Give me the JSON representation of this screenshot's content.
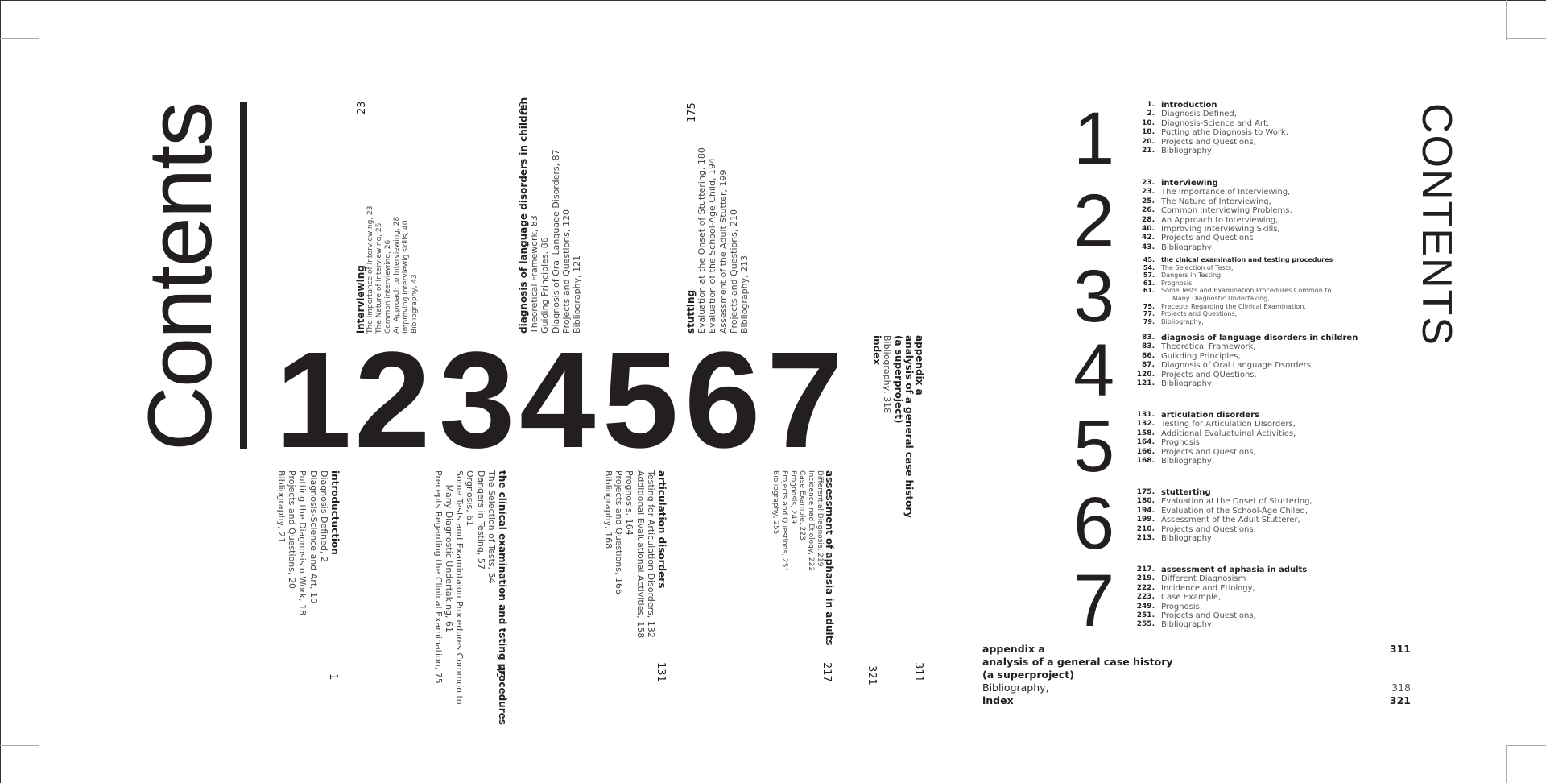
{
  "left": {
    "title": "Contents",
    "digits": [
      "1",
      "2",
      "3",
      "4",
      "5",
      "6",
      "7"
    ],
    "top_blocks": [
      {
        "num": "23",
        "heading": "interviewing",
        "items": [
          "The Importance of Interviewing, 23",
          "The Nature of Interviewing, 25",
          "Common interviewing, 26",
          "An Approach to Interviewing, 28",
          "Improving Interviewig skills, 40",
          "Bibliography, 43"
        ]
      },
      {
        "num": "83",
        "heading": "diagnosis of language disorders in children",
        "items": [
          "Theoretical Framework, 83",
          "Guiding Principles, 86",
          "Diagnosis of Oral Language Disorders, 87",
          "Projects and Questions, 120",
          "Bibliography, 121"
        ]
      },
      {
        "num": "175",
        "heading": "stutting",
        "items": [
          "Evaluation at the Onset of Stuttering, 180",
          "Evaluation  of the School-Age Child, 194",
          "Assessment of the Adult Stutter, 199",
          "Projects and Questions, 210",
          "Bibliography, 213"
        ]
      }
    ],
    "appendix_block": {
      "lines": [
        "appendix a",
        "analysis of a general case history",
        "(a superproject)",
        "Bibliography, 318",
        "index"
      ]
    },
    "bottom_blocks": [
      {
        "num": "1",
        "heading": "introductuction",
        "items": [
          "Diagnosis Defined, 2",
          "Diagnosis-Science and Art, 10",
          "Putting the Diagnosis o Work, 18",
          "Projects and Questions, 20",
          "Bibliography, 21"
        ]
      },
      {
        "num": "45",
        "heading": "the clinical examination and tsting procedures",
        "items": [
          "The Selection of Tests, 54",
          "Dangers in Testing, 57",
          "Orgnosis, 61",
          "Some Tests and Examintaion Procedures Common to",
          "     Many Diagnostic Undertaking, 61",
          "Precepts Regarding the Clinical Examination, 75"
        ]
      },
      {
        "num": "131",
        "heading": "articulation disorders",
        "items": [
          "Testing for Articulation Disorders, 132",
          "Additional Evaluational Activities, 158",
          "Prognosis, 164",
          "Projects and Questions, 166",
          "Bibliography, 168"
        ]
      },
      {
        "num": "217",
        "heading": "assessment of aphasia in adults",
        "items": [
          "Differential Diagnosis, 219",
          "Incidence nad Etiology, 222",
          "Case Example, 223",
          "Prognosis, 249",
          "Projects and Questions, 251",
          "Bibliography, 255"
        ]
      }
    ],
    "bottom_nums_extra": [
      "321",
      "311"
    ]
  },
  "right": {
    "title": "CONTENTS",
    "digits": [
      "1",
      "2",
      "3",
      "4",
      "5",
      "6",
      "7"
    ],
    "sections": [
      {
        "rows": [
          [
            "1.",
            "introduction"
          ],
          [
            "2.",
            "Diagnosis Defined,"
          ],
          [
            "10.",
            "Diagnosis-Science and Art,"
          ],
          [
            "18.",
            "Putting athe Diagnosis to Work,"
          ],
          [
            "20.",
            "Projects and Questions,"
          ],
          [
            "21.",
            "Bibliography,"
          ]
        ]
      },
      {
        "rows": [
          [
            "23.",
            "interviewing"
          ],
          [
            "23.",
            "The Importance of Interviewing,"
          ],
          [
            "25.",
            "The Nature of Interviewing,"
          ],
          [
            "26.",
            "Common Interviewing Problems,"
          ],
          [
            "28.",
            "An Approach to Interviewing,"
          ],
          [
            "40.",
            "Improving Interviewing Skills,"
          ],
          [
            "42.",
            "Projects and Questions"
          ],
          [
            "43.",
            "Bibliography"
          ]
        ]
      },
      {
        "rows": [
          [
            "45.",
            "the clnical examination and testing procedures"
          ],
          [
            "54.",
            "The Selection of Tests,"
          ],
          [
            "57.",
            "Dangers in Testing,"
          ],
          [
            "61.",
            "Prognosis,"
          ],
          [
            "61.",
            "Some Tests and Examination Procedures Common to"
          ],
          [
            "",
            "Many Diagnostic Undertaking,"
          ],
          [
            "75.",
            "Precepts Regarding the Clinical Examination,"
          ],
          [
            "77.",
            "Projects and Questions,"
          ],
          [
            "79.",
            "Bibliography,"
          ]
        ]
      },
      {
        "rows": [
          [
            "83.",
            "diagnosis of language disorders in children"
          ],
          [
            "83.",
            "Theoretical Framework,"
          ],
          [
            "86.",
            "Guikding Principles,"
          ],
          [
            "87.",
            "Diagnosis of Oral Language Dsorders,"
          ],
          [
            "120.",
            "Projects and QUestions,"
          ],
          [
            "121.",
            "Bibliography,"
          ]
        ]
      },
      {
        "rows": [
          [
            "131.",
            "articulation disorders"
          ],
          [
            "132.",
            "Testing for Articulation DIsorders,"
          ],
          [
            "158.",
            "Additional Evaluatuinal Activities,"
          ],
          [
            "164.",
            "Prognosis,"
          ],
          [
            "166.",
            "Projects and Questions,"
          ],
          [
            "168.",
            "Bibliography,"
          ]
        ]
      },
      {
        "rows": [
          [
            "175.",
            "stutterting"
          ],
          [
            "180.",
            "Evaluation at  the Onset of Stuttering,"
          ],
          [
            "194.",
            "Evaluation of the School-Age Chiled,"
          ],
          [
            "199.",
            "Assessment of the Adult Stutterer,"
          ],
          [
            "210.",
            "Projects and Questions,"
          ],
          [
            "213.",
            "Bibliography,"
          ]
        ]
      },
      {
        "rows": [
          [
            "217.",
            "assessment of aphasia in adults"
          ],
          [
            "219.",
            "Different Diagnosism"
          ],
          [
            "222.",
            "Incidence and Etiology,"
          ],
          [
            "223.",
            "Case Example,"
          ],
          [
            "249.",
            "Prognosis,"
          ],
          [
            "251.",
            "Projects and Questions,"
          ],
          [
            "255.",
            "Bibliography,"
          ]
        ]
      }
    ],
    "appendix": [
      {
        "label": "appendix a",
        "num": "311",
        "bold": true
      },
      {
        "label": "analysis of a general case history",
        "num": "",
        "bold": true
      },
      {
        "label": "(a superproject)",
        "num": "",
        "bold": true
      },
      {
        "label": "Bibliography,",
        "num": "318",
        "bold": false
      },
      {
        "label": "index",
        "num": "321",
        "bold": true
      }
    ]
  }
}
